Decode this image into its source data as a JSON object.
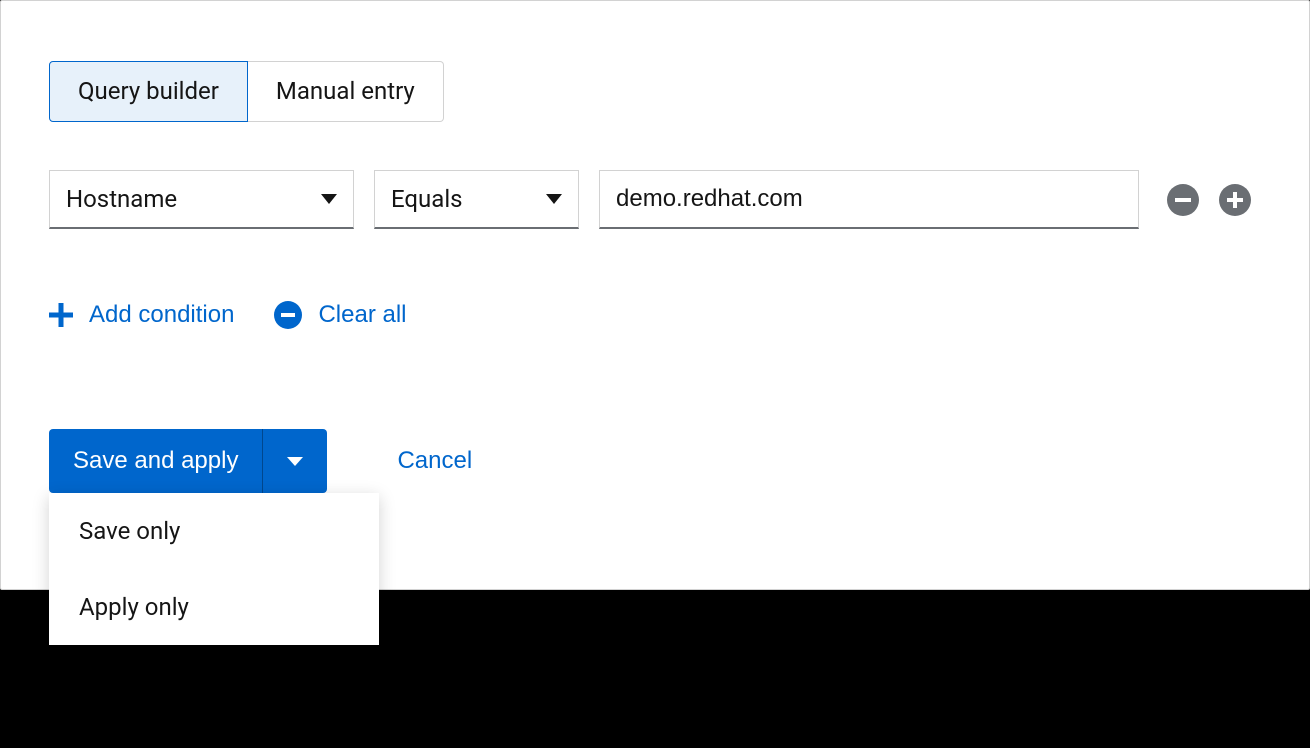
{
  "tabs": {
    "query_builder": "Query builder",
    "manual_entry": "Manual entry"
  },
  "condition": {
    "field": "Hostname",
    "operator": "Equals",
    "value": "demo.redhat.com"
  },
  "actions": {
    "add_condition": "Add condition",
    "clear_all": "Clear all"
  },
  "buttons": {
    "save_and_apply": "Save and apply",
    "cancel": "Cancel"
  },
  "dropdown": {
    "save_only": "Save only",
    "apply_only": "Apply only"
  }
}
